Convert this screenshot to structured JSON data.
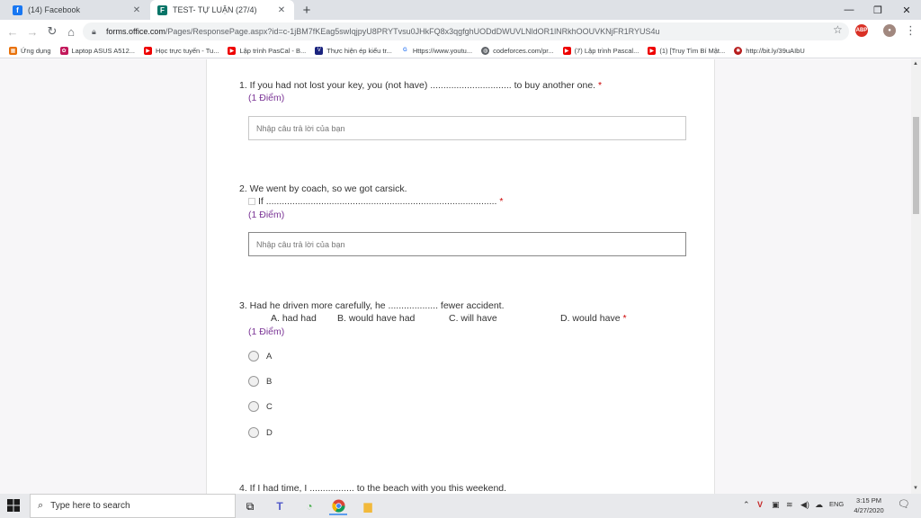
{
  "browser": {
    "tabs": [
      {
        "label": "(14) Facebook",
        "icon": "facebook-icon",
        "active": false
      },
      {
        "label": "TEST- TỰ LUẬN (27/4)",
        "icon": "forms-icon",
        "active": true
      }
    ],
    "new_tab": "+",
    "address": {
      "host": "forms.office.com",
      "path": "/Pages/ResponsePage.aspx?id=c-1jBM7fKEag5swIqjpyU8PRYTvsu0JHkFQ8x3qgfghUODdDWUVLNldOR1lNRkhOOUVKNjFR1RYUS4u"
    },
    "bookmarks": [
      {
        "label": "Ứng dụng",
        "icon": "apps-icon"
      },
      {
        "label": "Laptop ASUS A512...",
        "icon": "asus-icon"
      },
      {
        "label": "Học trực tuyến - Tu...",
        "icon": "youtube-icon"
      },
      {
        "label": "Lập trình PasCal - B...",
        "icon": "youtube-icon"
      },
      {
        "label": "Thực hiện ép kiểu tr...",
        "icon": "vj-icon"
      },
      {
        "label": "Https://www.youtu...",
        "icon": "google-icon"
      },
      {
        "label": "codeforces.com/pr...",
        "icon": "globe-icon"
      },
      {
        "label": "(7) Lập trình Pascal...",
        "icon": "youtube-icon"
      },
      {
        "label": "(1) [Truy Tìm Bí Mật...",
        "icon": "youtube-icon"
      },
      {
        "label": "http://bit.ly/39uAIbU",
        "icon": "bug-icon"
      }
    ]
  },
  "form": {
    "q1": {
      "text": "1. If you had not lost your key, you (not have) ............................... to buy another one.",
      "required": "*",
      "points": "(1 Điểm)",
      "placeholder": "Nhập câu trả lời của bạn"
    },
    "q2": {
      "text": "2. We went by coach, so we got carsick.",
      "line2": "If ........................................................................................",
      "required": "*",
      "points": "(1 Điểm)",
      "placeholder": "Nhập câu trả lời của bạn"
    },
    "q3": {
      "text": "3. Had he driven more carefully, he ................... fewer accident.",
      "options_line": [
        "A. had had",
        "B. would have had",
        "C. will have",
        "D. would have"
      ],
      "required": "*",
      "points": "(1 Điểm)",
      "choices": [
        "A",
        "B",
        "C",
        "D"
      ]
    },
    "q4": {
      "text": "4.  If I had time, I ................. to the beach with you this weekend."
    }
  },
  "taskbar": {
    "search_placeholder": "Type here to search",
    "language": "ENG",
    "time": "3:15 PM",
    "date": "4/27/2020"
  },
  "colors": {
    "points": "#7b3596",
    "required": "#cc0000",
    "tab_strip": "#dee1e6"
  }
}
